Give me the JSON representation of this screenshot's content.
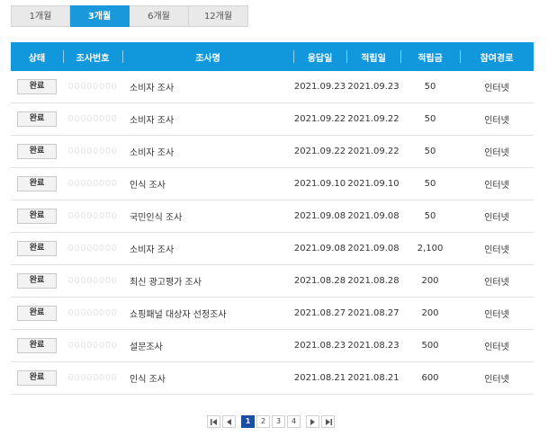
{
  "period_tabs": [
    {
      "label": "1개월"
    },
    {
      "label": "3개월"
    },
    {
      "label": "6개월"
    },
    {
      "label": "12개월"
    }
  ],
  "active_tab": "3개월",
  "table": {
    "headers": {
      "status": "상태",
      "survey_no": "조사번호",
      "survey_name": "조사명",
      "response_date": "응답일",
      "earn_date": "적립일",
      "points": "적립금",
      "channel": "참여경로"
    },
    "rows": [
      {
        "status": "완료",
        "survey_no": "00000000",
        "name": "소비자 조사",
        "response_date": "2021.09.23",
        "earn_date": "2021.09.23",
        "points": "50",
        "channel": "인터넷"
      },
      {
        "status": "완료",
        "survey_no": "00000000",
        "name": "소비자 조사",
        "response_date": "2021.09.22",
        "earn_date": "2021.09.22",
        "points": "50",
        "channel": "인터넷"
      },
      {
        "status": "완료",
        "survey_no": "00000000",
        "name": "소비자 조사",
        "response_date": "2021.09.22",
        "earn_date": "2021.09.22",
        "points": "50",
        "channel": "인터넷"
      },
      {
        "status": "완료",
        "survey_no": "00000000",
        "name": "인식 조사",
        "response_date": "2021.09.10",
        "earn_date": "2021.09.10",
        "points": "50",
        "channel": "인터넷"
      },
      {
        "status": "완료",
        "survey_no": "00000000",
        "name": "국민인식 조사",
        "response_date": "2021.09.08",
        "earn_date": "2021.09.08",
        "points": "50",
        "channel": "인터넷"
      },
      {
        "status": "완료",
        "survey_no": "00000000",
        "name": "소비자 조사",
        "response_date": "2021.09.08",
        "earn_date": "2021.09.08",
        "points": "2,100",
        "channel": "인터넷"
      },
      {
        "status": "완료",
        "survey_no": "00000000",
        "name": "최신 광고평가 조사",
        "response_date": "2021.08.28",
        "earn_date": "2021.08.28",
        "points": "200",
        "channel": "인터넷"
      },
      {
        "status": "완료",
        "survey_no": "00000000",
        "name": "쇼핑패널 대상자 선정조사",
        "response_date": "2021.08.27",
        "earn_date": "2021.08.27",
        "points": "200",
        "channel": "인터넷"
      },
      {
        "status": "완료",
        "survey_no": "00000000",
        "name": "설문조사",
        "response_date": "2021.08.23",
        "earn_date": "2021.08.23",
        "points": "500",
        "channel": "인터넷"
      },
      {
        "status": "완료",
        "survey_no": "00000000",
        "name": "인식 조사",
        "response_date": "2021.08.21",
        "earn_date": "2021.08.21",
        "points": "600",
        "channel": "인터넷"
      }
    ]
  },
  "pagination": {
    "pages": [
      "1",
      "2",
      "3",
      "4"
    ],
    "current": "1",
    "icons": {
      "first": "first-page-icon",
      "prev": "prev-page-icon",
      "next": "next-page-icon",
      "last": "last-page-icon"
    }
  },
  "colors": {
    "accent": "#1197dc",
    "active_page": "#1d4fa0"
  }
}
